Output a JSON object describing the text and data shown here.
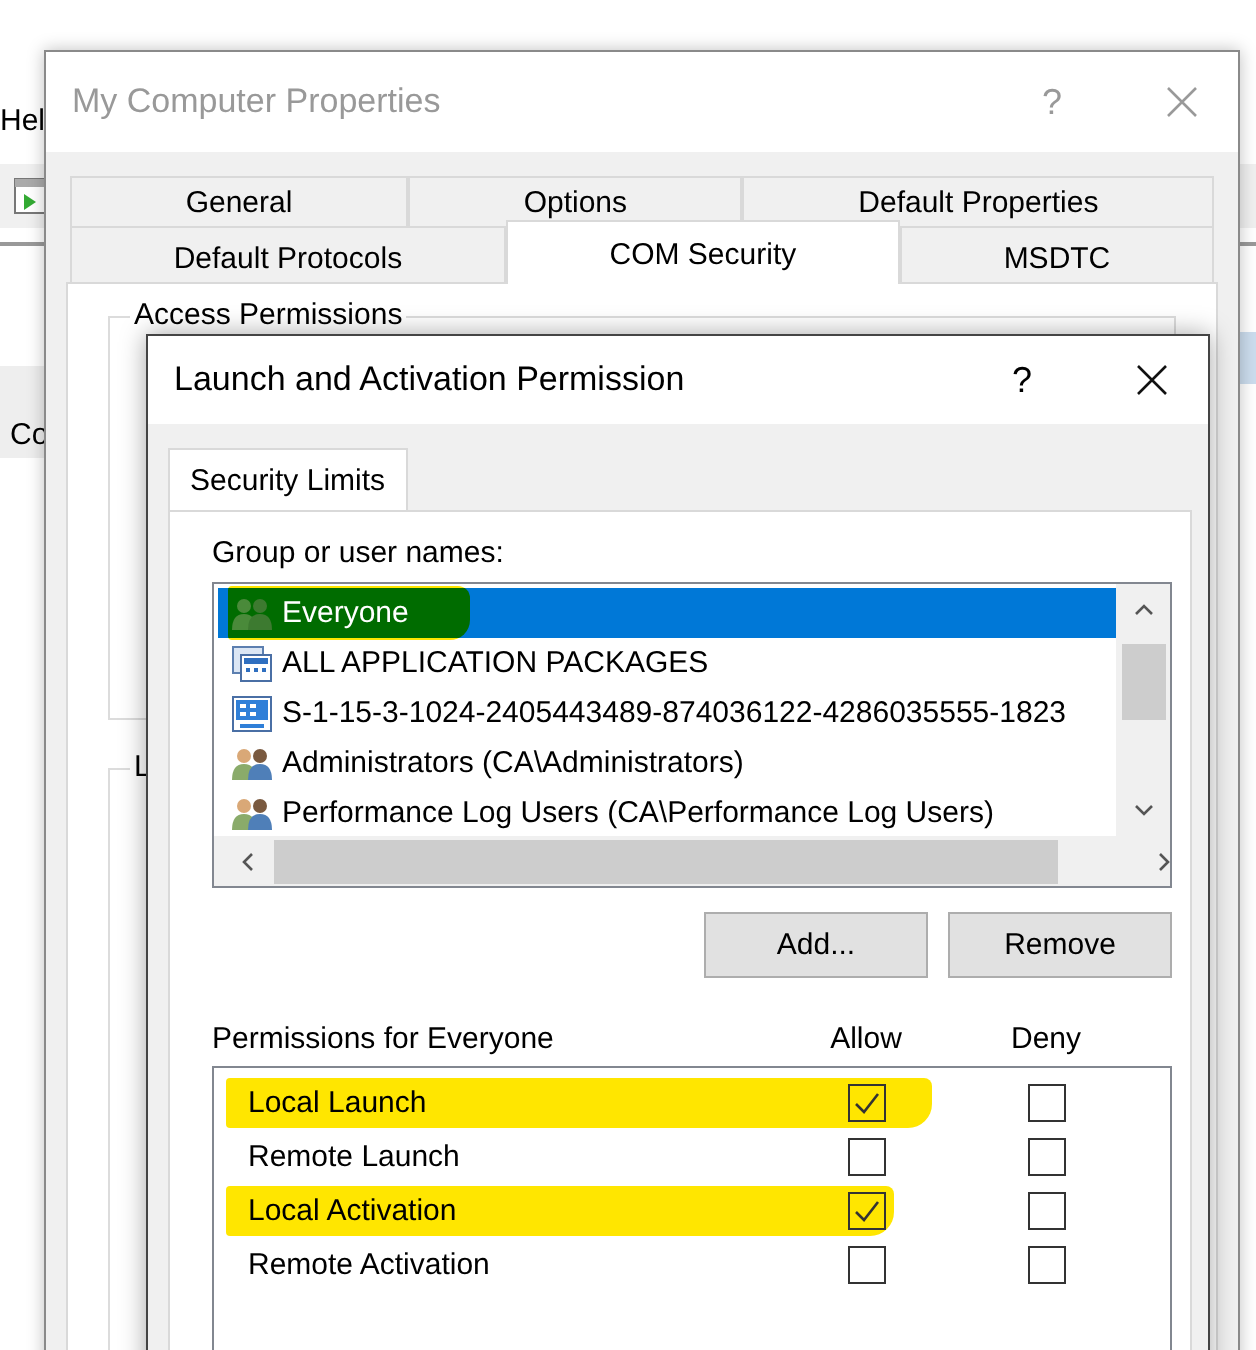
{
  "background_app": {
    "menu_text": "Hel",
    "left_text": "Co"
  },
  "properties_dialog": {
    "title": "My Computer Properties",
    "help": "?",
    "tab_rows": [
      [
        {
          "label": "General",
          "selected": false
        },
        {
          "label": "Options",
          "selected": false
        },
        {
          "label": "Default Properties",
          "selected": false
        }
      ],
      [
        {
          "label": "Default Protocols",
          "selected": false
        },
        {
          "label": "COM Security",
          "selected": true
        },
        {
          "label": "MSDTC",
          "selected": false
        }
      ]
    ],
    "groups": [
      "Access Permissions",
      "L"
    ]
  },
  "permission_dialog": {
    "title": "Launch and Activation Permission",
    "help": "?",
    "tabs": [
      {
        "label": "Security Limits",
        "selected": true
      }
    ],
    "users_label": "Group or user names:",
    "users": [
      {
        "name": "Everyone",
        "kind": "group",
        "selected": true,
        "highlighted": true
      },
      {
        "name": "ALL APPLICATION PACKAGES",
        "kind": "package",
        "selected": false,
        "highlighted": false
      },
      {
        "name": "S-1-15-3-1024-2405443489-874036122-4286035555-1823",
        "kind": "app",
        "selected": false,
        "highlighted": false
      },
      {
        "name": "Administrators (CA\\Administrators)",
        "kind": "users",
        "selected": false,
        "highlighted": false
      },
      {
        "name": "Performance Log Users (CA\\Performance Log Users)",
        "kind": "users",
        "selected": false,
        "highlighted": false
      }
    ],
    "buttons": [
      "Add...",
      "Remove"
    ],
    "permissions_label": "Permissions for Everyone",
    "columns": [
      "Allow",
      "Deny"
    ],
    "permissions": [
      {
        "name": "Local Launch",
        "allow": true,
        "deny": false,
        "highlighted": true
      },
      {
        "name": "Remote Launch",
        "allow": false,
        "deny": false,
        "highlighted": false
      },
      {
        "name": "Local Activation",
        "allow": true,
        "deny": false,
        "highlighted": true
      },
      {
        "name": "Remote Activation",
        "allow": false,
        "deny": false,
        "highlighted": false
      }
    ]
  }
}
